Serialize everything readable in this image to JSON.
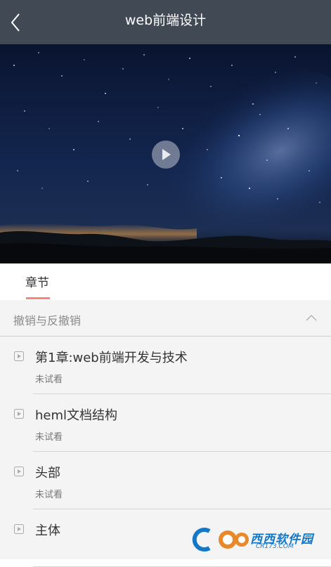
{
  "header": {
    "title": "web前端设计"
  },
  "video": {
    "state": "paused"
  },
  "tabs": [
    {
      "label": "章节",
      "active": true
    }
  ],
  "section": {
    "title": "撤销与反撤销",
    "expanded": true
  },
  "lessons": [
    {
      "title": "第1章:web前端开发与技术",
      "status": "未试看"
    },
    {
      "title": "heml文档结构",
      "status": "未试看"
    },
    {
      "title": "头部",
      "status": "未试看"
    },
    {
      "title": "主体",
      "status": ""
    }
  ],
  "watermark": {
    "text": "西西软件园",
    "sub": "CR173.COM"
  },
  "colors": {
    "header_bg": "#414a54",
    "tab_accent": "#f4877a",
    "content_bg": "#f4f4f4",
    "watermark_blue": "#1478c8"
  }
}
